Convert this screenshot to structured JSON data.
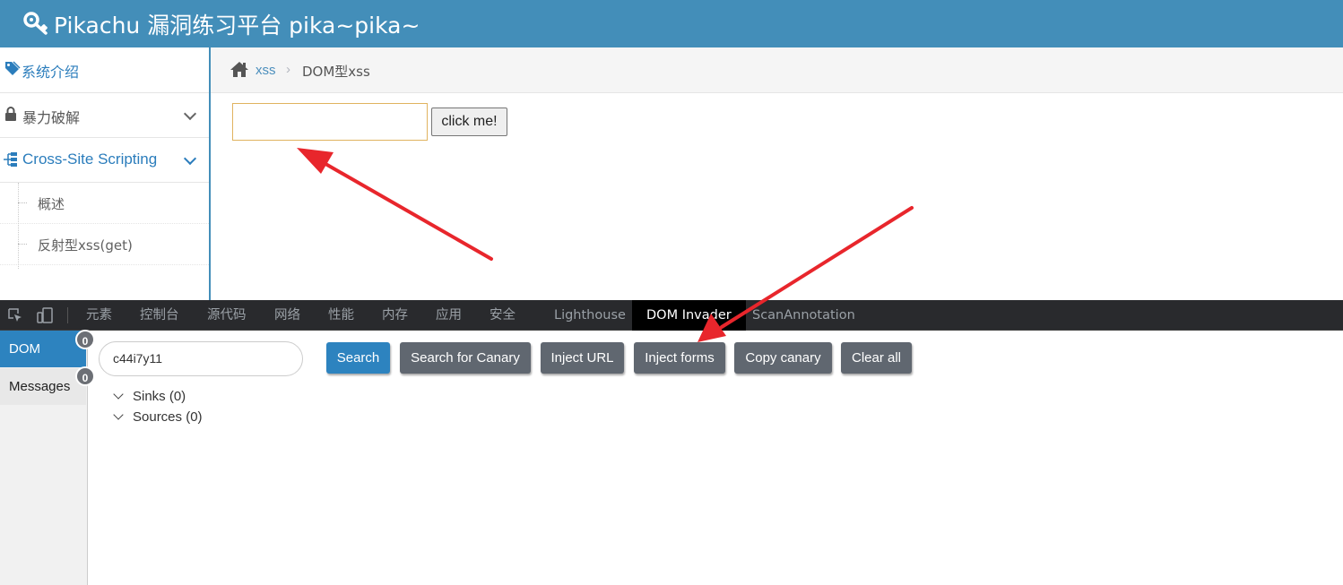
{
  "header": {
    "title": "Pikachu 漏洞练习平台 pika~pika~",
    "icon": "key-icon"
  },
  "sidebar": {
    "items": [
      {
        "label": "系统介绍",
        "icon": "tags-icon"
      },
      {
        "label": "暴力破解",
        "icon": "lock-icon"
      },
      {
        "label": "Cross-Site Scripting",
        "icon": "sitemap-icon"
      }
    ],
    "subitems": [
      {
        "label": "概述"
      },
      {
        "label": "反射型xss(get)"
      }
    ]
  },
  "breadcrumbs": {
    "home_icon": "home-icon",
    "items": [
      "xss",
      "DOM型xss"
    ],
    "separator": "›"
  },
  "page": {
    "input_value": "",
    "button_label": "click me!"
  },
  "devtools": {
    "tabs": [
      "元素",
      "控制台",
      "源代码",
      "网络",
      "性能",
      "内存",
      "应用",
      "安全",
      "Lighthouse",
      "DOM Invader",
      "ScanAnnotation"
    ],
    "active_tab": "DOM Invader",
    "side_tabs": [
      {
        "label": "DOM",
        "count": "0"
      },
      {
        "label": "Messages",
        "count": "0"
      }
    ],
    "canary_value": "c44i7y11",
    "buttons": [
      "Search",
      "Search for Canary",
      "Inject URL",
      "Inject forms",
      "Copy canary",
      "Clear all"
    ],
    "tree": [
      {
        "label": "Sinks (0)"
      },
      {
        "label": "Sources (0)"
      }
    ]
  },
  "colors": {
    "header_bg": "#438eb9",
    "accent": "#2d83bf",
    "secondary_button": "#606770",
    "devtools_bar": "#292a2d",
    "annotation_arrow": "#e8262c"
  }
}
